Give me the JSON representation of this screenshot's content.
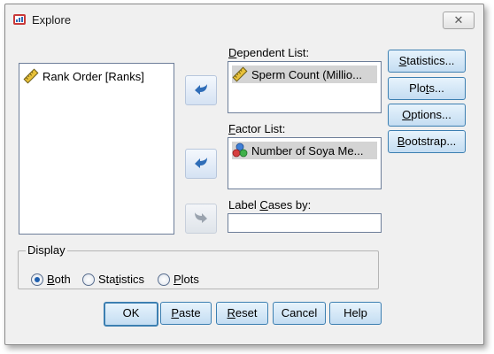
{
  "window": {
    "title": "Explore",
    "close_glyph": "✕"
  },
  "source_list": {
    "items": [
      {
        "label": "Rank Order [Ranks]",
        "icon": "ruler-icon"
      }
    ]
  },
  "dependent_list": {
    "label_mnemonic": "D",
    "label_rest": "ependent List:",
    "items": [
      {
        "label": "Sperm Count (Millio...",
        "icon": "ruler-icon"
      }
    ]
  },
  "factor_list": {
    "label_mnemonic": "F",
    "label_rest": "actor List:",
    "items": [
      {
        "label": "Number of Soya Me...",
        "icon": "nominal-icon"
      }
    ]
  },
  "label_cases": {
    "label_pre": "Label ",
    "label_mnemonic": "C",
    "label_rest": "ases by:",
    "value": ""
  },
  "side_buttons": {
    "statistics": {
      "mnemonic": "S",
      "rest": "tatistics..."
    },
    "plots": {
      "pre": "Plo",
      "mnemonic": "t",
      "rest": "s..."
    },
    "options": {
      "mnemonic": "O",
      "rest": "ptions..."
    },
    "bootstrap": {
      "mnemonic": "B",
      "rest": "ootstrap..."
    }
  },
  "display": {
    "legend": "Display",
    "options": [
      {
        "mnemonic": "B",
        "rest": "oth",
        "checked": true
      },
      {
        "pre": "Sta",
        "mnemonic": "t",
        "rest": "istics",
        "checked": false
      },
      {
        "mnemonic": "P",
        "rest": "lots",
        "checked": false
      }
    ]
  },
  "bottom_buttons": {
    "ok": "OK",
    "paste": {
      "mnemonic": "P",
      "rest": "aste"
    },
    "reset": {
      "mnemonic": "R",
      "rest": "eset"
    },
    "cancel": "Cancel",
    "help": "Help"
  },
  "colors": {
    "dialog_bg": "#f0f0f0",
    "button_border": "#3c7fb1",
    "arrow_blue": "#2f6db8"
  }
}
